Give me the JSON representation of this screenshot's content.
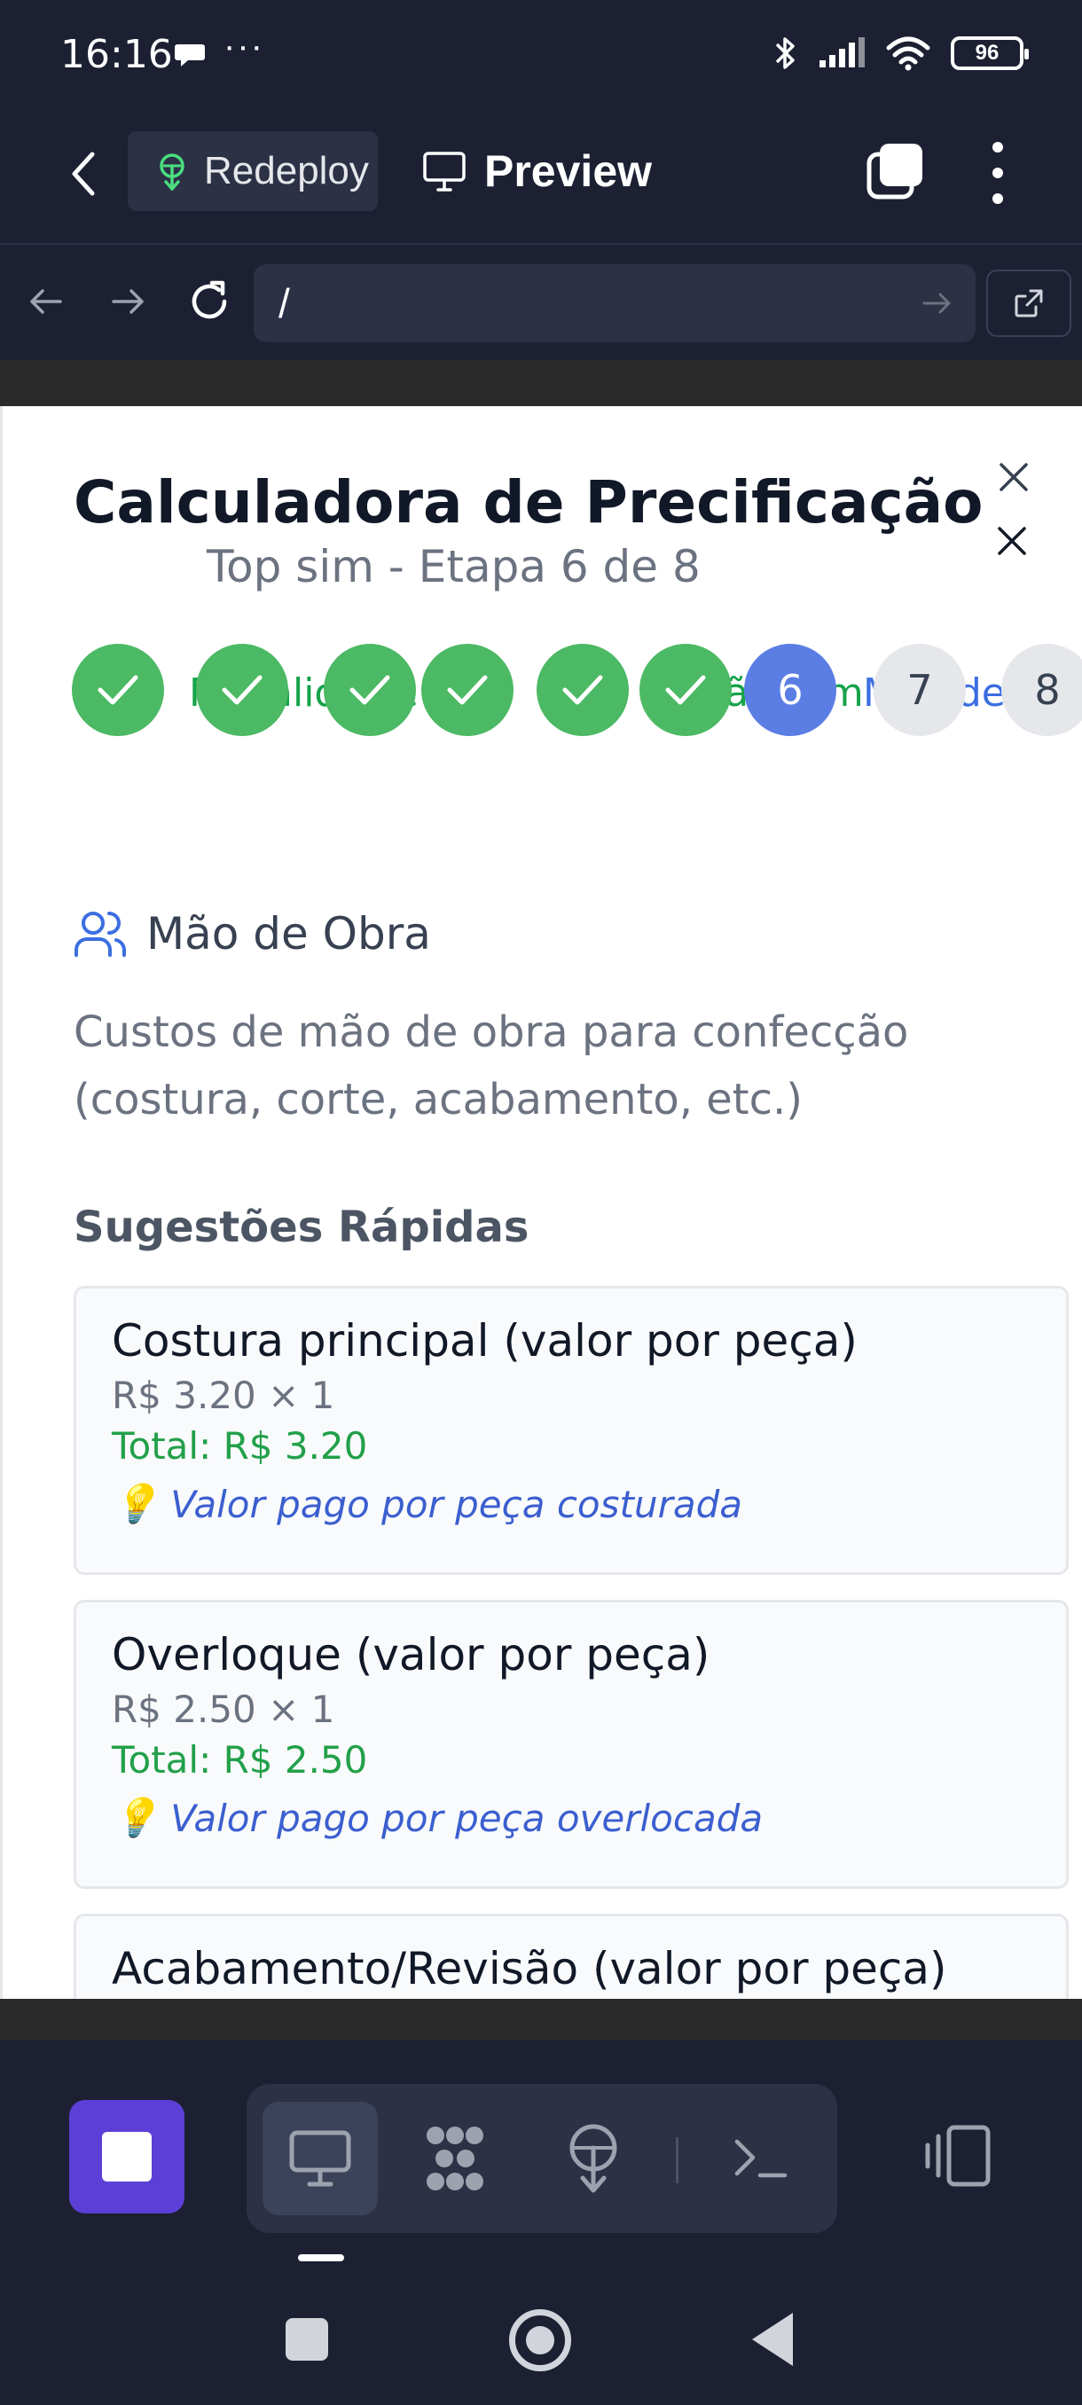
{
  "status_bar": {
    "time": "16:16",
    "dots": "···",
    "battery": "96"
  },
  "app_bar": {
    "redeploy_label": "Redeploy",
    "preview_label": "Preview"
  },
  "url_bar": {
    "url": "/"
  },
  "modal": {
    "title": "Calculadora de Precificação",
    "subtitle": "Top sim - Etapa 6 de 8",
    "steps": [
      {
        "number": "",
        "status": "done"
      },
      {
        "number": "",
        "status": "done"
      },
      {
        "number": "",
        "status": "done"
      },
      {
        "number": "",
        "status": "done"
      },
      {
        "number": "",
        "status": "done"
      },
      {
        "number": "",
        "status": "done"
      },
      {
        "number": "6",
        "status": "current"
      },
      {
        "number": "7",
        "status": "todo"
      },
      {
        "number": "8",
        "status": "todo"
      }
    ],
    "step_label_fragments": [
      "M",
      "alid",
      "c",
      "d",
      "a",
      "ção",
      "um",
      "Mão de Ob"
    ],
    "section": {
      "title": "Mão de Obra",
      "description": "Custos de mão de obra para confecção (costura, corte, acabamento, etc.)",
      "quick_title": "Sugestões Rápidas"
    },
    "suggestions": [
      {
        "name": "Costura principal (valor por peça)",
        "qty": "R$ 3.20 × 1",
        "total": "Total: R$ 3.20",
        "tip": "Valor pago por peça costurada",
        "tip_icon": "💡"
      },
      {
        "name": "Overloque (valor por peça)",
        "qty": "R$ 2.50 × 1",
        "total": "Total: R$ 2.50",
        "tip": "Valor pago por peça overlocada",
        "tip_icon": "💡"
      },
      {
        "name": "Acabamento/Revisão (valor por peça)"
      }
    ]
  },
  "colors": {
    "accent": "#5c3fd6",
    "done": "#4cb964",
    "current": "#5b7ee5",
    "total": "#22a04a",
    "tip": "#3b5fd0"
  }
}
